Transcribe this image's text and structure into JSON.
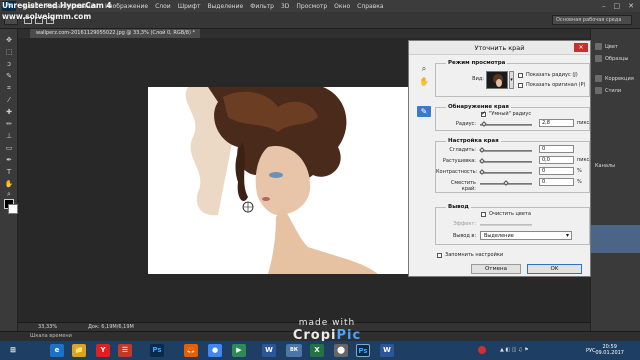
{
  "watermark": {
    "line1": "Unregistered HyperCam 4",
    "line2": "www.solveigmm.com"
  },
  "menubar": {
    "app_logo": "Ps",
    "items": [
      "Файл",
      "Редактирование",
      "Изображение",
      "Слои",
      "Шрифт",
      "Выделение",
      "Фильтр",
      "3D",
      "Просмотр",
      "Окно",
      "Справка"
    ],
    "window_buttons": [
      "–",
      "□",
      "✕"
    ]
  },
  "options_bar": {
    "workspace_select": "Основная рабочая среда"
  },
  "document_tab": {
    "label": "wallperz.com-20161129055022.jpg @ 33,3% (Слой 0, RGB/8) *"
  },
  "status_bar": {
    "zoom": "33,33%",
    "doc_info": "Док: 6,19M/6,19M"
  },
  "mini_bridge": {
    "label": "Шкала времени"
  },
  "right_panels": {
    "items": [
      "Цвет",
      "Образцы",
      "Коррекция",
      "Стили"
    ],
    "layers_label": "Слои",
    "channels_label": "Каналы"
  },
  "dialog": {
    "title": "Уточнить край",
    "view_mode": {
      "title": "Режим просмотра",
      "view_label": "Вид:",
      "show_radius": "Показать радиус (J)",
      "show_original": "Показать оригинал (P)"
    },
    "edge_detection": {
      "title": "Обнаружение края",
      "smart_radius": "\"Умный\" радиус",
      "radius_label": "Радиус:",
      "radius_value": "2,8",
      "radius_unit": "пикс.",
      "radius_fraction": 0.05
    },
    "adjust_edge": {
      "title": "Настройка края",
      "rows": [
        {
          "label": "Сгладить:",
          "value": "0",
          "unit": "",
          "fraction": 0.0
        },
        {
          "label": "Растушевка:",
          "value": "0,0",
          "unit": "пикс.",
          "fraction": 0.0
        },
        {
          "label": "Контрастность:",
          "value": "0",
          "unit": "%",
          "fraction": 0.0
        },
        {
          "label": "Сместить край:",
          "value": "0",
          "unit": "%",
          "fraction": 0.5
        }
      ]
    },
    "output": {
      "title": "Вывод",
      "decontaminate": "Очистить цвета",
      "amount_label": "Эффект:",
      "output_to_label": "Вывод в:",
      "output_to_value": "Выделение"
    },
    "remember_settings": "Запомнить настройки",
    "cancel": "Отмена",
    "ok": "OK",
    "close": "✕"
  },
  "taskbar": {
    "apps": [
      "e",
      "📁",
      "Y",
      "☰",
      "Ps",
      "🦊",
      "●",
      "▶",
      "W",
      "ВК",
      "X",
      "⬤",
      "Ps",
      "W"
    ],
    "time": "20:59",
    "date": "09.01.2017",
    "lang": "РУС"
  },
  "cropi": {
    "line1": "made with",
    "line2a": "Cropi",
    "line2b": "Pic"
  }
}
